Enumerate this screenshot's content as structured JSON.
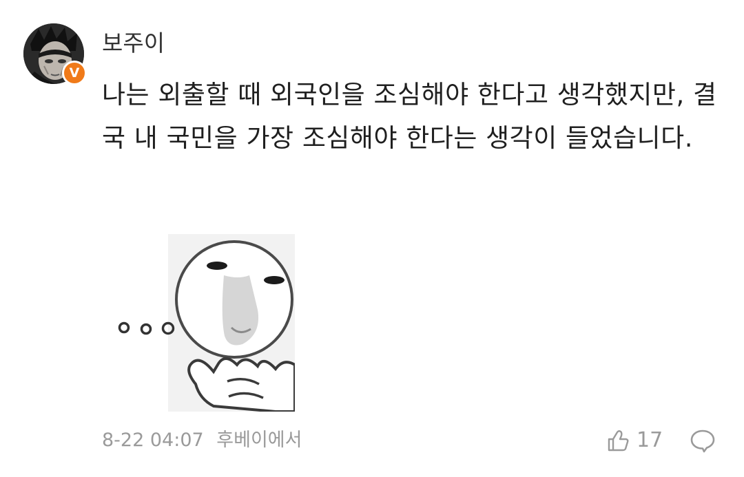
{
  "comment": {
    "username": "보주이",
    "verified_badge": "V",
    "text": "나는 외출할 때 외국인을 조심해야 한다고 생각했지만, 결국 내 국민을 가장 조심해야 한다는 생각이 들었습니다.",
    "date": "8-22 04:07",
    "source": "후베이에서",
    "like_count": "17",
    "sticker": "thinking-face-sticker"
  },
  "icons": {
    "like": "thumbs-up-icon",
    "reply": "comment-bubble-icon",
    "badge": "verified-badge-icon"
  },
  "colors": {
    "badge": "#f07a19",
    "meta_text": "#9a9a9a",
    "body_text": "#1f1f1f"
  }
}
